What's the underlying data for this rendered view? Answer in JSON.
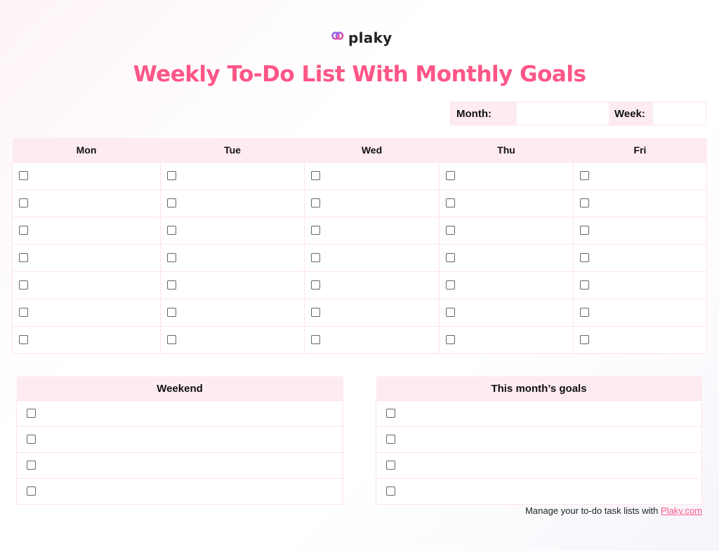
{
  "brand": {
    "name": "plaky",
    "logo_icon": "plaky-logo-icon",
    "accent_color": "#fd5687",
    "header_fill": "#fdebf1"
  },
  "title": "Weekly To-Do List With Monthly Goals",
  "meta": {
    "month_label": "Month:",
    "month_value": "",
    "week_label": "Week:",
    "week_value": ""
  },
  "weekdays": {
    "columns": [
      "Mon",
      "Tue",
      "Wed",
      "Thu",
      "Fri"
    ],
    "rows_per_day": 7
  },
  "weekend": {
    "title": "Weekend",
    "rows": 4
  },
  "goals": {
    "title": "This month’s goals",
    "rows": 4
  },
  "footer": {
    "text": "Manage your to-do task lists with ",
    "link_label": "Plaky.com"
  }
}
